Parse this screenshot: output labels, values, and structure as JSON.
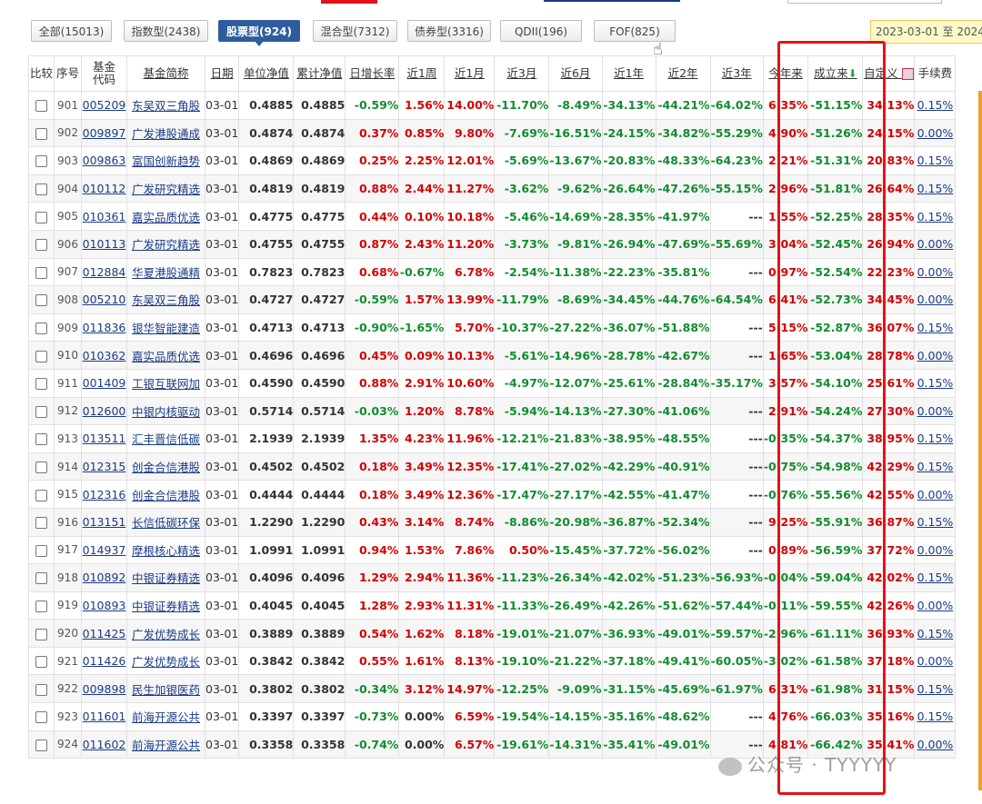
{
  "tabs": [
    {
      "label": "全部(15013)",
      "active": false
    },
    {
      "label": "指数型(2438)",
      "active": false
    },
    {
      "label": "股票型(924)",
      "active": true
    },
    {
      "label": "混合型(7312)",
      "active": false
    },
    {
      "label": "债券型(3316)",
      "active": false
    },
    {
      "label": "QDII(196)",
      "active": false
    },
    {
      "label": "FOF(825)",
      "active": false
    }
  ],
  "date_range": "2023-03-01 至 2024-0",
  "columns": [
    "比较",
    "序号",
    "基金代码",
    "基金简称",
    "日期",
    "单位净值",
    "累计净值",
    "日增长率",
    "近1周",
    "近1月",
    "近3月",
    "近6月",
    "近1年",
    "近2年",
    "近3年",
    "今年来",
    "成立来",
    "自定义",
    "手续费"
  ],
  "rows": [
    [
      "901",
      "005209",
      "东吴双三角股",
      "03-01",
      "0.4885",
      "0.4885",
      "-0.59%",
      "1.56%",
      "14.00%",
      "-11.70%",
      "-8.49%",
      "-34.13%",
      "-44.21%",
      "-64.02%",
      "6.35%",
      "-51.15%",
      "34.13%",
      "0.15%"
    ],
    [
      "902",
      "009897",
      "广发港股通成",
      "03-01",
      "0.4874",
      "0.4874",
      "0.37%",
      "0.85%",
      "9.80%",
      "-7.69%",
      "-16.51%",
      "-24.15%",
      "-34.82%",
      "-55.29%",
      "4.90%",
      "-51.26%",
      "24.15%",
      "0.00%"
    ],
    [
      "903",
      "009863",
      "富国创新趋势",
      "03-01",
      "0.4869",
      "0.4869",
      "0.25%",
      "2.25%",
      "12.01%",
      "-5.69%",
      "-13.67%",
      "-20.83%",
      "-48.33%",
      "-64.23%",
      "2.21%",
      "-51.31%",
      "20.83%",
      "0.15%"
    ],
    [
      "904",
      "010112",
      "广发研究精选",
      "03-01",
      "0.4819",
      "0.4819",
      "0.88%",
      "2.44%",
      "11.27%",
      "-3.62%",
      "-9.62%",
      "-26.64%",
      "-47.26%",
      "-55.15%",
      "2.96%",
      "-51.81%",
      "26.64%",
      "0.15%"
    ],
    [
      "905",
      "010361",
      "嘉实品质优选",
      "03-01",
      "0.4775",
      "0.4775",
      "0.44%",
      "0.10%",
      "10.18%",
      "-5.46%",
      "-14.69%",
      "-28.35%",
      "-41.97%",
      "---",
      "1.55%",
      "-52.25%",
      "28.35%",
      "0.15%"
    ],
    [
      "906",
      "010113",
      "广发研究精选",
      "03-01",
      "0.4755",
      "0.4755",
      "0.87%",
      "2.43%",
      "11.20%",
      "-3.73%",
      "-9.81%",
      "-26.94%",
      "-47.69%",
      "-55.69%",
      "3.04%",
      "-52.45%",
      "26.94%",
      "0.00%"
    ],
    [
      "907",
      "012884",
      "华夏港股通精",
      "03-01",
      "0.7823",
      "0.7823",
      "0.68%",
      "-0.67%",
      "6.78%",
      "-2.54%",
      "-11.38%",
      "-22.23%",
      "-35.81%",
      "---",
      "0.97%",
      "-52.54%",
      "22.23%",
      "0.00%"
    ],
    [
      "908",
      "005210",
      "东吴双三角股",
      "03-01",
      "0.4727",
      "0.4727",
      "-0.59%",
      "1.57%",
      "13.99%",
      "-11.79%",
      "-8.69%",
      "-34.45%",
      "-44.76%",
      "-64.54%",
      "6.41%",
      "-52.73%",
      "34.45%",
      "0.00%"
    ],
    [
      "909",
      "011836",
      "银华智能建造",
      "03-01",
      "0.4713",
      "0.4713",
      "-0.90%",
      "-1.65%",
      "5.70%",
      "-10.37%",
      "-27.22%",
      "-36.07%",
      "-51.88%",
      "---",
      "5.15%",
      "-52.87%",
      "36.07%",
      "0.15%"
    ],
    [
      "910",
      "010362",
      "嘉实品质优选",
      "03-01",
      "0.4696",
      "0.4696",
      "0.45%",
      "0.09%",
      "10.13%",
      "-5.61%",
      "-14.96%",
      "-28.78%",
      "-42.67%",
      "---",
      "1.65%",
      "-53.04%",
      "28.78%",
      "0.00%"
    ],
    [
      "911",
      "001409",
      "工银互联网加",
      "03-01",
      "0.4590",
      "0.4590",
      "0.88%",
      "2.91%",
      "10.60%",
      "-4.97%",
      "-12.07%",
      "-25.61%",
      "-28.84%",
      "-35.17%",
      "3.57%",
      "-54.10%",
      "25.61%",
      "0.15%"
    ],
    [
      "912",
      "012600",
      "中银内核驱动",
      "03-01",
      "0.5714",
      "0.5714",
      "-0.03%",
      "1.20%",
      "8.78%",
      "-5.94%",
      "-14.13%",
      "-27.30%",
      "-41.06%",
      "---",
      "2.91%",
      "-54.24%",
      "27.30%",
      "0.00%"
    ],
    [
      "913",
      "013511",
      "汇丰晋信低碳",
      "03-01",
      "2.1939",
      "2.1939",
      "1.35%",
      "4.23%",
      "11.96%",
      "-12.21%",
      "-21.83%",
      "-38.95%",
      "-48.55%",
      "---",
      "-0.35%",
      "-54.37%",
      "38.95%",
      "0.15%"
    ],
    [
      "914",
      "012315",
      "创金合信港股",
      "03-01",
      "0.4502",
      "0.4502",
      "0.18%",
      "3.49%",
      "12.35%",
      "-17.41%",
      "-27.02%",
      "-42.29%",
      "-40.91%",
      "---",
      "-0.75%",
      "-54.98%",
      "42.29%",
      "0.15%"
    ],
    [
      "915",
      "012316",
      "创金合信港股",
      "03-01",
      "0.4444",
      "0.4444",
      "0.18%",
      "3.49%",
      "12.36%",
      "-17.47%",
      "-27.17%",
      "-42.55%",
      "-41.47%",
      "---",
      "-0.76%",
      "-55.56%",
      "42.55%",
      "0.00%"
    ],
    [
      "916",
      "013151",
      "长信低碳环保",
      "03-01",
      "1.2290",
      "1.2290",
      "0.43%",
      "3.14%",
      "8.74%",
      "-8.86%",
      "-20.98%",
      "-36.87%",
      "-52.34%",
      "---",
      "9.25%",
      "-55.91%",
      "36.87%",
      "0.15%"
    ],
    [
      "917",
      "014937",
      "摩根核心精选",
      "03-01",
      "1.0991",
      "1.0991",
      "0.94%",
      "1.53%",
      "7.86%",
      "0.50%",
      "-15.45%",
      "-37.72%",
      "-56.02%",
      "---",
      "0.89%",
      "-56.59%",
      "37.72%",
      "0.00%"
    ],
    [
      "918",
      "010892",
      "中银证券精选",
      "03-01",
      "0.4096",
      "0.4096",
      "1.29%",
      "2.94%",
      "11.36%",
      "-11.23%",
      "-26.34%",
      "-42.02%",
      "-51.23%",
      "-56.93%",
      "-0.04%",
      "-59.04%",
      "42.02%",
      "0.15%"
    ],
    [
      "919",
      "010893",
      "中银证券精选",
      "03-01",
      "0.4045",
      "0.4045",
      "1.28%",
      "2.93%",
      "11.31%",
      "-11.33%",
      "-26.49%",
      "-42.26%",
      "-51.62%",
      "-57.44%",
      "-0.11%",
      "-59.55%",
      "42.26%",
      "0.00%"
    ],
    [
      "920",
      "011425",
      "广发优势成长",
      "03-01",
      "0.3889",
      "0.3889",
      "0.54%",
      "1.62%",
      "8.18%",
      "-19.01%",
      "-21.07%",
      "-36.93%",
      "-49.01%",
      "-59.57%",
      "-2.96%",
      "-61.11%",
      "36.93%",
      "0.15%"
    ],
    [
      "921",
      "011426",
      "广发优势成长",
      "03-01",
      "0.3842",
      "0.3842",
      "0.55%",
      "1.61%",
      "8.13%",
      "-19.10%",
      "-21.22%",
      "-37.18%",
      "-49.41%",
      "-60.05%",
      "-3.02%",
      "-61.58%",
      "37.18%",
      "0.00%"
    ],
    [
      "922",
      "009898",
      "民生加银医药",
      "03-01",
      "0.3802",
      "0.3802",
      "-0.34%",
      "3.12%",
      "14.97%",
      "-12.25%",
      "-9.09%",
      "-31.15%",
      "-45.69%",
      "-61.97%",
      "6.31%",
      "-61.98%",
      "31.15%",
      "0.15%"
    ],
    [
      "923",
      "011601",
      "前海开源公共",
      "03-01",
      "0.3397",
      "0.3397",
      "-0.73%",
      "0.00%",
      "6.59%",
      "-19.54%",
      "-14.15%",
      "-35.16%",
      "-48.62%",
      "---",
      "4.76%",
      "-66.03%",
      "35.16%",
      "0.15%"
    ],
    [
      "924",
      "011602",
      "前海开源公共",
      "03-01",
      "0.3358",
      "0.3358",
      "-0.74%",
      "0.00%",
      "6.57%",
      "-19.61%",
      "-14.31%",
      "-35.41%",
      "-49.01%",
      "---",
      "4.81%",
      "-66.42%",
      "35.41%",
      "0.00%"
    ]
  ],
  "watermark": "公众号 · TYYYYY",
  "colors": {
    "up": "#d40000",
    "down": "#118c2e",
    "link": "#1a3b86",
    "highlight": "#e0141a"
  }
}
